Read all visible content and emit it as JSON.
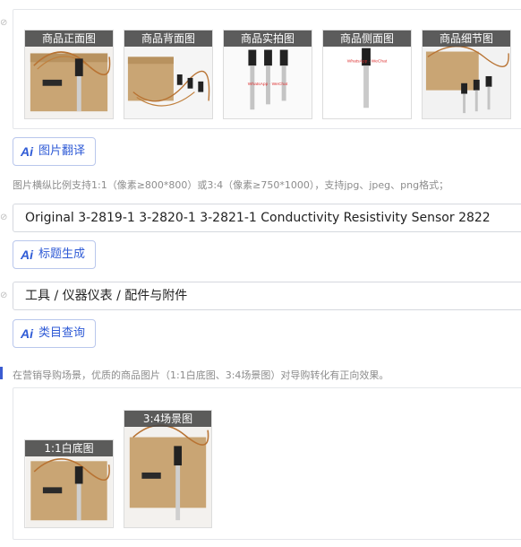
{
  "product_images": [
    {
      "label": "商品正面图",
      "icon": "product-photo-icon"
    },
    {
      "label": "商品背面图",
      "icon": "product-photo-icon"
    },
    {
      "label": "商品实拍图",
      "icon": "product-photo-icon"
    },
    {
      "label": "商品侧面图",
      "icon": "product-photo-icon"
    },
    {
      "label": "商品细节图",
      "icon": "product-photo-icon"
    }
  ],
  "image_translate_button": {
    "ai": "Ai",
    "label": "图片翻译"
  },
  "image_ratio_hint": "图片横纵比例支持1:1（像素≥800*800）或3:4（像素≥750*1000），支持jpg、jpeg、png格式；",
  "title_field": {
    "value": "Original 3-2819-1 3-2820-1 3-2821-1 Conductivity Resistivity Sensor 2822"
  },
  "title_generate_button": {
    "ai": "Ai",
    "label": "标题生成"
  },
  "category_field": {
    "value": "工具 / 仪器仪表 / 配件与附件"
  },
  "category_query_button": {
    "ai": "Ai",
    "label": "类目查询"
  },
  "scene_hint": "在营销导购场景，优质的商品图片（1:1白底图、3:4场景图）对导购转化有正向效果。",
  "scene_images": [
    {
      "label": "1:1白底图"
    },
    {
      "label": "3:4场景图"
    }
  ],
  "colors": {
    "accent": "#2f5bd6",
    "border": "#e4e6ea",
    "label_bg": "#464646"
  }
}
